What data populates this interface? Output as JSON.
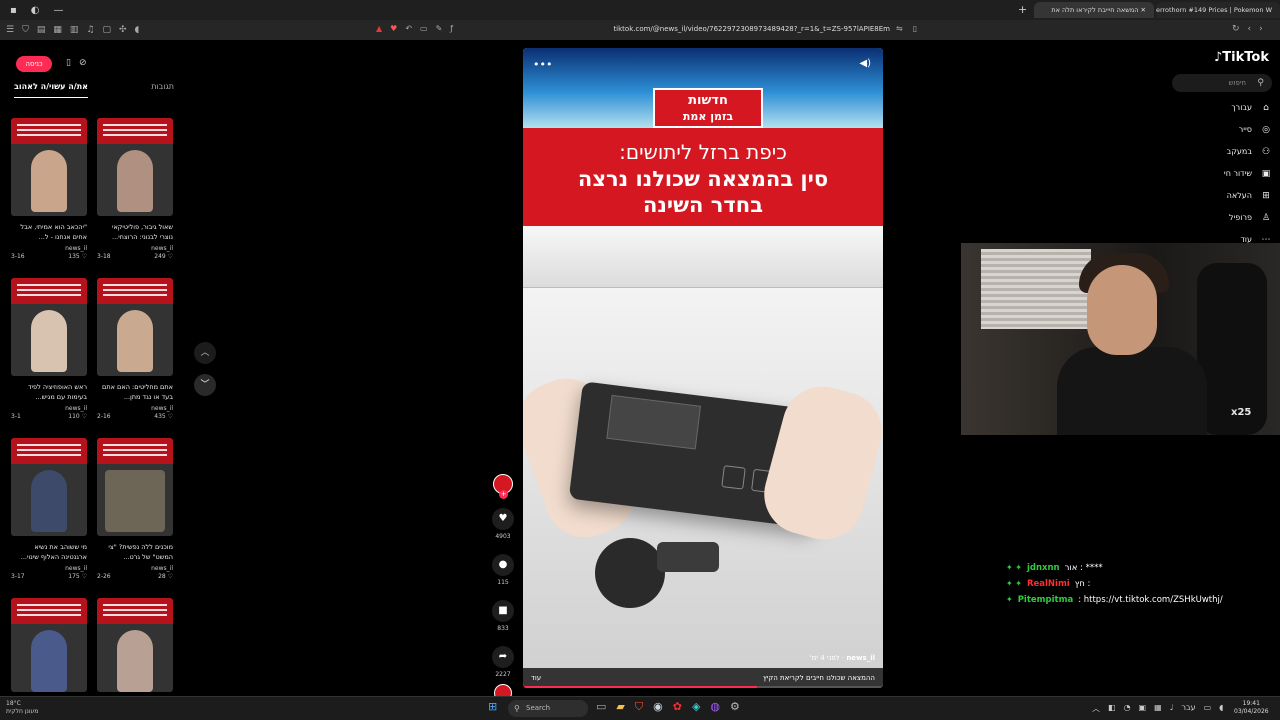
{
  "browser": {
    "tabs": [
      {
        "label": "המשאה חיייבת לקיראו תלה את",
        "active": true
      },
      {
        "label": "Ferrothorn #149 Prices | Pokemon W",
        "active": false
      }
    ],
    "url": "tiktok.com/@news_il/video/7622972308973489428?_r=1&_t=ZS-957lAPIE8Em"
  },
  "left_panel": {
    "pill_label": "כניסה",
    "tabs": [
      "את/ה עשוי/ה לאהוב",
      "תגובות"
    ],
    "cards": [
      {
        "title": "\"יהכאב הוא אמיתי, אבל אחים אנחנו - ל...",
        "user": "news_il",
        "date": "3-16",
        "likes": "135"
      },
      {
        "title": "שאול גיבור, פוליטיקאי נוצרי לבנוני: הרוצחי...",
        "user": "news_il",
        "date": "3-18",
        "likes": "249"
      },
      {
        "title": "ראש האופוזיציה לפיד בעימות עם מגיש...",
        "user": "news_il",
        "date": "3-1",
        "likes": "110"
      },
      {
        "title": "אתם מחליטים: האם אתם בעד או נגד מתן...",
        "user": "news_il",
        "date": "2-16",
        "likes": "435"
      },
      {
        "title": "מי ששוהב את נשיא ארגנטינה האלוף שינוי...",
        "user": "news_il",
        "date": "3-17",
        "likes": "175"
      },
      {
        "title": "מוכנים ללה נפשית? \"צי המשט\" של גרט...",
        "user": "news_il",
        "date": "2-26",
        "likes": "28"
      },
      {
        "title": "",
        "user": "",
        "date": "",
        "likes": ""
      },
      {
        "title": "",
        "user": "",
        "date": "",
        "likes": ""
      }
    ]
  },
  "video": {
    "logo_top": "חדשות",
    "logo_bottom": "בזמן אמת",
    "headline1": "כיפת ברזל ליתושים:",
    "headline2a": "סין בהמצאה שכולנו נרצה",
    "headline2b": "בחדר השינה",
    "caption_user": "news_il",
    "caption_time": "לפני 4 ימ'",
    "caption_text": "ההמצאה שכולנו חייבים לקריאת הקיץ",
    "caption_more": "עוד",
    "progress": 0.65
  },
  "actions": [
    {
      "icon": "heart-icon",
      "glyph": "♥",
      "count": "4903"
    },
    {
      "icon": "comment-icon",
      "glyph": "●",
      "count": "115"
    },
    {
      "icon": "bookmark-icon",
      "glyph": "■",
      "count": "833"
    },
    {
      "icon": "share-icon",
      "glyph": "➦",
      "count": "2227"
    }
  ],
  "tiktok_nav": {
    "logo": "TikTok",
    "search_placeholder": "חיפוש",
    "items": [
      {
        "label": "עבורך",
        "glyph": "⌂"
      },
      {
        "label": "סייר",
        "glyph": "◎"
      },
      {
        "label": "במעקב",
        "glyph": "⚇"
      },
      {
        "label": "שידור חי",
        "glyph": "▣"
      },
      {
        "label": "העלאה",
        "glyph": "⊞"
      },
      {
        "label": "פרופיל",
        "glyph": "♙"
      },
      {
        "label": "עוד",
        "glyph": "⋯"
      }
    ]
  },
  "webcam": {
    "badge": "x25"
  },
  "chat": [
    {
      "user": "jdnxnn",
      "user_color": "#2ecc40",
      "message": "אור : ****"
    },
    {
      "user": "RealNimi",
      "user_color": "#ff2d2d",
      "message": "חץ :"
    },
    {
      "user": "Pitempitma",
      "user_color": "#2ecc40",
      "message": ": https://vt.tiktok.com/ZSHkUwthj/"
    }
  ],
  "taskbar": {
    "weather_temp": "18°C",
    "weather_desc": "מעונן חלקית",
    "search_label": "Search",
    "time": "19:41",
    "date": "03/04/2026",
    "lang": "עבר"
  }
}
